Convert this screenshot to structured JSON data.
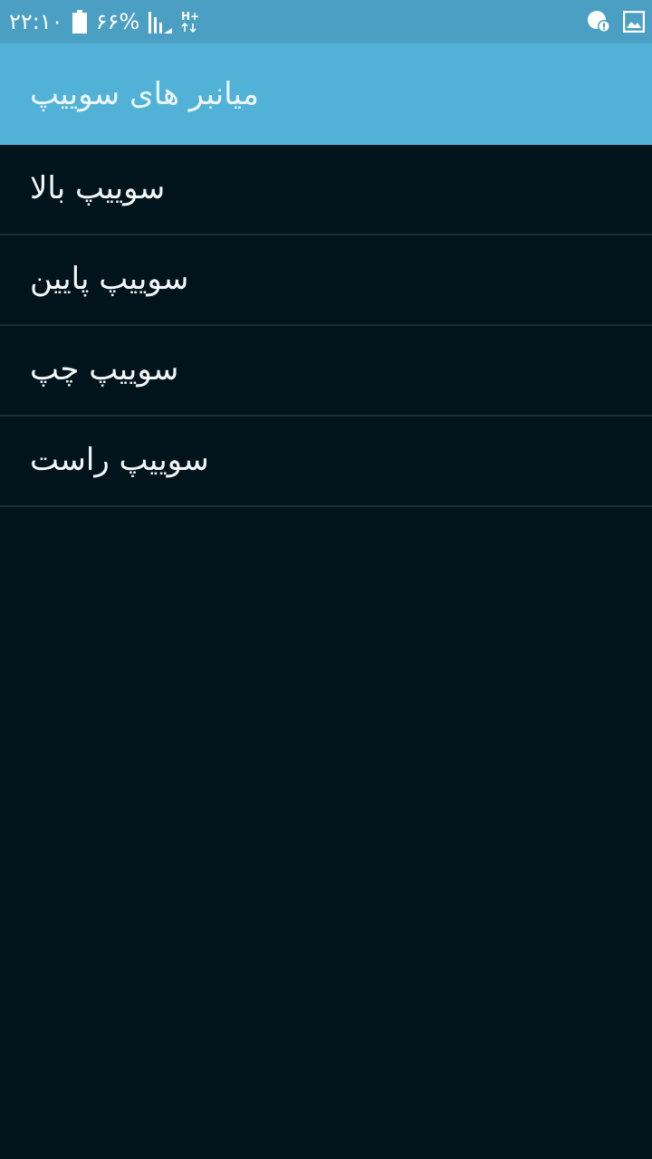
{
  "status_bar": {
    "time": "۲۲:۱۰",
    "battery": "۶۶%",
    "network": "H+",
    "icons": [
      "battery-icon",
      "signal-icon",
      "network-hplus-icon",
      "notification-alert-icon",
      "gallery-icon"
    ]
  },
  "app_bar": {
    "title": "میانبر های سوییپ"
  },
  "menu": {
    "items": [
      {
        "label": "سوییپ بالا"
      },
      {
        "label": "سوییپ پایین"
      },
      {
        "label": "سوییپ چپ"
      },
      {
        "label": "سوییپ راست"
      }
    ]
  },
  "colors": {
    "status_bar_bg": "#4a9fc3",
    "app_bar_bg": "#52b1d7",
    "background": "#01141c",
    "divider": "#1f2d33"
  }
}
